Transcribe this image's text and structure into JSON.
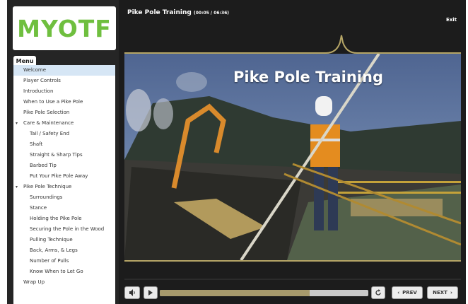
{
  "app": {
    "logo_text": "MYOTF",
    "course_title": "Pike Pole Training",
    "time": "(00:05 / 06:36)",
    "exit_label": "Exit"
  },
  "menu": {
    "tab_label": "Menu",
    "items": [
      {
        "label": "Welcome",
        "level": 0,
        "active": true
      },
      {
        "label": "Player Controls",
        "level": 0
      },
      {
        "label": "Introduction",
        "level": 0
      },
      {
        "label": "When to Use a Pike Pole",
        "level": 0
      },
      {
        "label": "Pike Pole Selection",
        "level": 0
      },
      {
        "label": "Care & Maintenance",
        "level": 0,
        "expanded": true
      },
      {
        "label": "Tail / Safety End",
        "level": 1
      },
      {
        "label": "Shaft",
        "level": 1
      },
      {
        "label": "Straight & Sharp Tips",
        "level": 1
      },
      {
        "label": "Barbed Tip",
        "level": 1
      },
      {
        "label": "Put Your Pike Pole Away",
        "level": 1
      },
      {
        "label": "Pike Pole Technique",
        "level": 0,
        "expanded": true
      },
      {
        "label": "Surroundings",
        "level": 1
      },
      {
        "label": "Stance",
        "level": 1
      },
      {
        "label": "Holding the Pike Pole",
        "level": 1
      },
      {
        "label": "Securing the Pole in the Wood",
        "level": 1
      },
      {
        "label": "Pulling Technique",
        "level": 1
      },
      {
        "label": "Back, Arms, & Legs",
        "level": 1
      },
      {
        "label": "Number of Pulls",
        "level": 1
      },
      {
        "label": "Know When to Let Go",
        "level": 1
      },
      {
        "label": "Wrap Up",
        "level": 0
      }
    ]
  },
  "video": {
    "title_overlay": "Pike Pole Training"
  },
  "controls": {
    "progress": 0.72,
    "prev_label": "PREV",
    "next_label": "NEXT",
    "volume_icon": "speaker-icon",
    "play_icon": "play-icon",
    "replay_icon": "replay-icon"
  },
  "colors": {
    "accent_gold": "#b5a566",
    "menu_active": "#d6e6f5",
    "logo_green": "#6fbf3f",
    "logo_blue": "#2c6fb0"
  }
}
